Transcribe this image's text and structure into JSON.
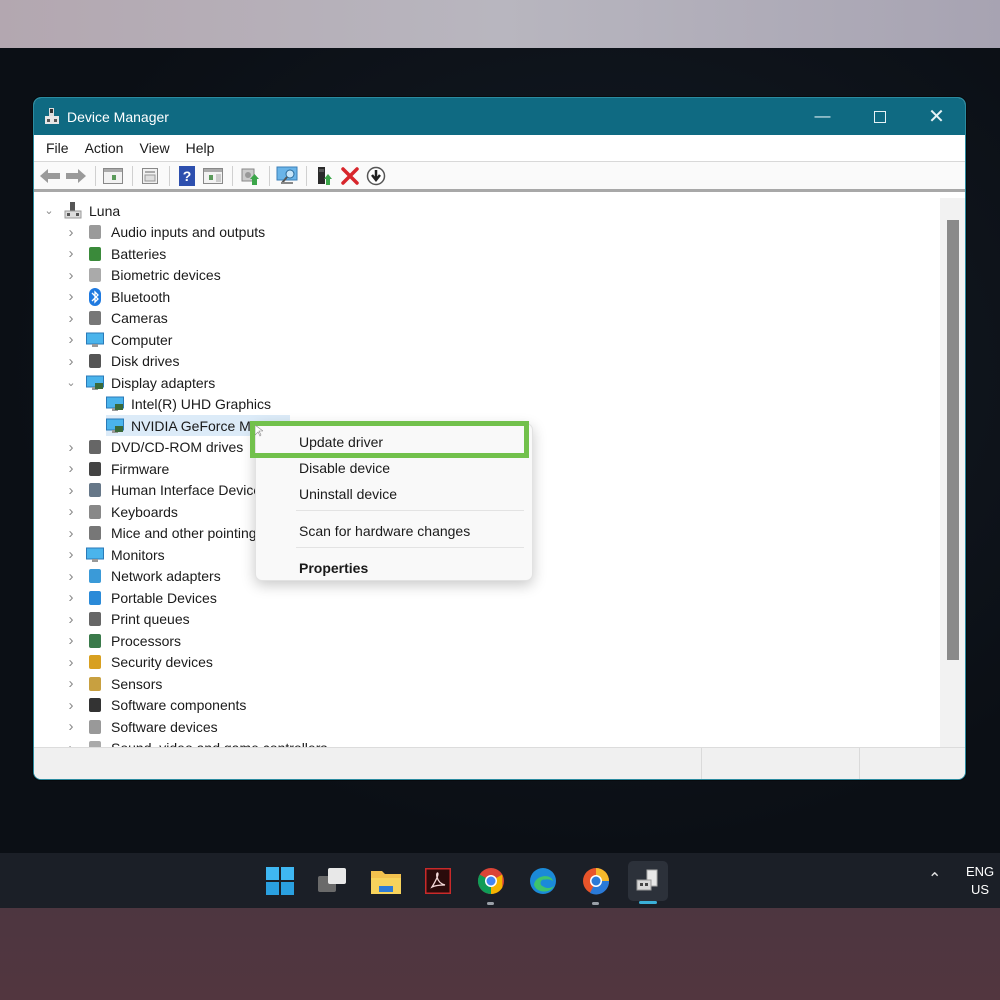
{
  "window": {
    "title": "Device Manager",
    "controls": {
      "minimize": "minimize",
      "maximize": "maximize",
      "close": "close"
    }
  },
  "menu": [
    "File",
    "Action",
    "View",
    "Help"
  ],
  "toolbar": [
    "back",
    "forward",
    "show-hide-console-tree",
    "properties",
    "help",
    "show-action-pane",
    "update-driver",
    "scan-for-hardware-changes",
    "add-legacy-hardware",
    "uninstall-device",
    "enable-device"
  ],
  "tree": {
    "root": "Luna",
    "items": [
      {
        "label": "Audio inputs and outputs",
        "icon": "speaker-icon",
        "expanded": false
      },
      {
        "label": "Batteries",
        "icon": "battery-icon",
        "expanded": false
      },
      {
        "label": "Biometric devices",
        "icon": "fingerprint-icon",
        "expanded": false
      },
      {
        "label": "Bluetooth",
        "icon": "bluetooth-icon",
        "expanded": false
      },
      {
        "label": "Cameras",
        "icon": "camera-icon",
        "expanded": false
      },
      {
        "label": "Computer",
        "icon": "computer-icon",
        "expanded": false
      },
      {
        "label": "Disk drives",
        "icon": "disk-drive-icon",
        "expanded": false
      },
      {
        "label": "Display adapters",
        "icon": "display-adapter-icon",
        "expanded": true,
        "children": [
          {
            "label": "Intel(R) UHD Graphics",
            "selected": false
          },
          {
            "label": "NVIDIA GeForce MX",
            "selected": true
          }
        ]
      },
      {
        "label": "DVD/CD-ROM drives",
        "icon": "dvd-drive-icon",
        "expanded": false
      },
      {
        "label": "Firmware",
        "icon": "firmware-icon",
        "expanded": false
      },
      {
        "label": "Human Interface Devices",
        "icon": "hid-icon",
        "expanded": false
      },
      {
        "label": "Keyboards",
        "icon": "keyboard-icon",
        "expanded": false
      },
      {
        "label": "Mice and other pointing devices",
        "icon": "mouse-icon",
        "expanded": false
      },
      {
        "label": "Monitors",
        "icon": "monitor-icon",
        "expanded": false
      },
      {
        "label": "Network adapters",
        "icon": "network-icon",
        "expanded": false
      },
      {
        "label": "Portable Devices",
        "icon": "portable-device-icon",
        "expanded": false
      },
      {
        "label": "Print queues",
        "icon": "printer-icon",
        "expanded": false
      },
      {
        "label": "Processors",
        "icon": "processor-icon",
        "expanded": false
      },
      {
        "label": "Security devices",
        "icon": "security-device-icon",
        "expanded": false
      },
      {
        "label": "Sensors",
        "icon": "sensor-icon",
        "expanded": false
      },
      {
        "label": "Software components",
        "icon": "software-component-icon",
        "expanded": false
      },
      {
        "label": "Software devices",
        "icon": "software-device-icon",
        "expanded": false
      },
      {
        "label": "Sound, video and game controllers",
        "icon": "sound-icon",
        "expanded": false
      }
    ]
  },
  "context_menu": {
    "items": [
      {
        "label": "Update driver",
        "highlighted": true
      },
      {
        "label": "Disable device"
      },
      {
        "label": "Uninstall device"
      },
      {
        "label": "Scan for hardware changes"
      },
      {
        "label": "Properties",
        "bold": true
      }
    ]
  },
  "taskbar": {
    "apps": [
      "start",
      "task-view",
      "file-explorer",
      "adobe-acrobat",
      "chrome",
      "edge",
      "chrome-canary",
      "device-manager"
    ],
    "language": {
      "line1": "ENG",
      "line2": "US"
    }
  },
  "colors": {
    "titlebar": "#0f6a82",
    "highlight": "#72c14c",
    "selection": "#dcebf8"
  }
}
